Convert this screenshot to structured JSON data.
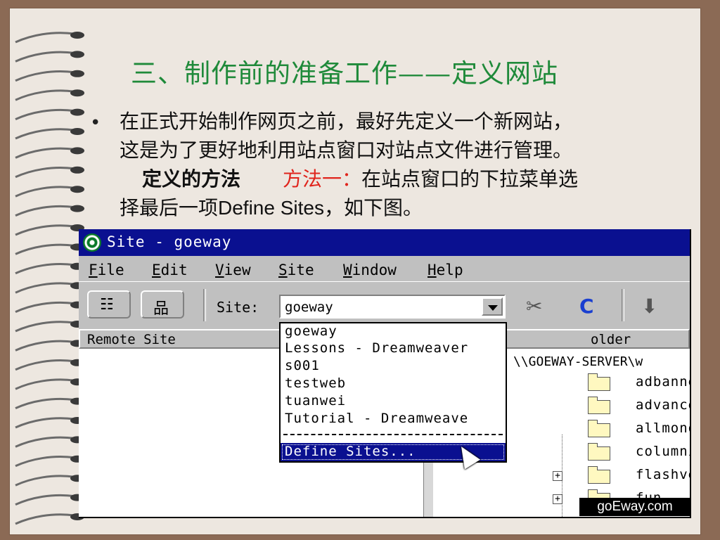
{
  "slide": {
    "title": "三、制作前的准备工作——定义网站",
    "bullet_symbol": "•",
    "para_line1": "在正式开始制作网页之前，最好先定义一个新网站，",
    "para_line2": "这是为了更好地利用站点窗口对站点文件进行管理。",
    "method_label": "定义的方法",
    "method_one": "方法一：",
    "method_one_text": "在站点窗口的下拉菜单选",
    "para_line4_a": "择最后一项",
    "para_line4_b": "Define Sites",
    "para_line4_c": "，如下图。"
  },
  "window": {
    "title": "Site - goeway",
    "menu": [
      {
        "key": "F",
        "rest": "ile"
      },
      {
        "key": "E",
        "rest": "dit"
      },
      {
        "key": "V",
        "rest": "iew"
      },
      {
        "key": "S",
        "rest": "ite"
      },
      {
        "key": "W",
        "rest": "indow"
      },
      {
        "key": "H",
        "rest": "elp"
      }
    ],
    "toolbar": {
      "site_label": "Site:",
      "site_value": "goeway",
      "list_view_glyph": "☷",
      "map_view_glyph": "品",
      "connect_glyph": "✂",
      "refresh_glyph": "C",
      "get_glyph": "⬇"
    },
    "dropdown": {
      "options": [
        "goeway",
        "Lessons - Dreamweaver",
        "s001",
        "testweb",
        "tuanwei",
        "Tutorial - Dreamweave"
      ],
      "separator": "----------------------",
      "selected": "Define Sites..."
    },
    "remote_pane": {
      "header": "Remote Site"
    },
    "local_pane": {
      "header": "older",
      "path": "\\\\GOEWAY-SERVER\\w",
      "folders": [
        "adbanner",
        "advanced",
        "allmono",
        "columnist",
        "flashversion",
        "fun"
      ]
    }
  },
  "watermark": "goEway.com",
  "colors": {
    "title_green": "#1f8a3a",
    "accent_red": "#e0241c",
    "titlebar_blue": "#0a1090"
  }
}
